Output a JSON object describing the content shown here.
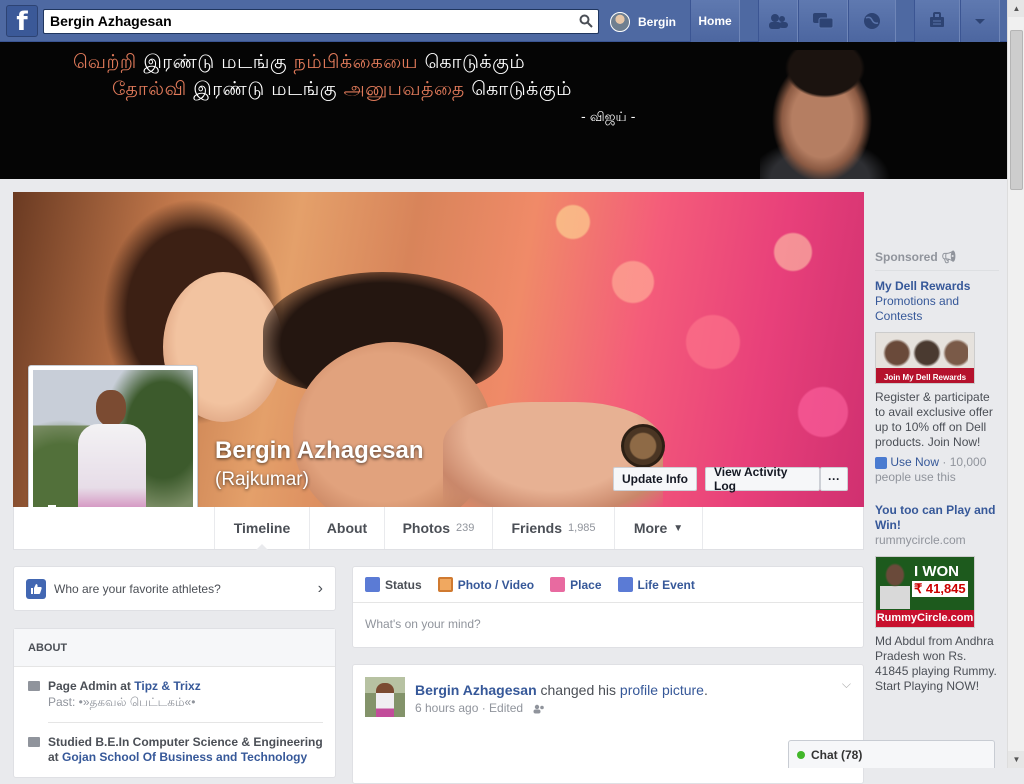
{
  "topbar": {
    "logo": "f",
    "search_value": "Bergin Azhagesan",
    "profile_name": "Bergin",
    "home_label": "Home",
    "icons": [
      "friends-icon",
      "messages-icon",
      "globe-icon",
      "privacy-icon",
      "account-menu-icon"
    ]
  },
  "banner": {
    "line1_hl1": "வெற்றி",
    "line1_mid": "இரண்டு மடங்கு",
    "line1_hl2": "நம்பிக்கையை",
    "line1_end": "கொடுக்கும்",
    "line2_hl1": "தோல்வி",
    "line2_mid": "இரண்டு மடங்கு",
    "line2_hl2": "அனுபவத்தை",
    "line2_end": "கொடுக்கும்",
    "signature": "- விஜய் -"
  },
  "cover": {
    "name": "Bergin Azhagesan",
    "alt_name": "(Rajkumar)",
    "update_info": "Update Info",
    "activity_log": "View Activity Log",
    "more_dots": "···"
  },
  "tabs": [
    {
      "label": "Timeline",
      "count": ""
    },
    {
      "label": "About",
      "count": ""
    },
    {
      "label": "Photos",
      "count": "239"
    },
    {
      "label": "Friends",
      "count": "1,985"
    },
    {
      "label": "More",
      "count": ""
    }
  ],
  "athletes_prompt": "Who are your favorite athletes?",
  "about": {
    "header": "ABOUT",
    "work_prefix": "Page Admin at ",
    "work_place": "Tipz & Trixz",
    "work_past": "Past: •»தகவல் பெட்டகம்«•",
    "edu_prefix": "Studied B.E.In Computer Science & Engineering",
    "edu_at": "at ",
    "edu_school": "Gojan School Of Business and Technology"
  },
  "composer": {
    "status": "Status",
    "photo_video": "Photo / Video",
    "place": "Place",
    "life_event": "Life Event",
    "placeholder": "What's on your mind?"
  },
  "post": {
    "author": "Bergin Azhagesan",
    "action": " changed his ",
    "object": "profile picture",
    "end": ".",
    "time": "6 hours ago · Edited"
  },
  "sponsored": {
    "label": "Sponsored",
    "ad1_title": "My Dell Rewards",
    "ad1_sub": "Promotions and Contests",
    "ad1_img_text": "Join My Dell Rewards",
    "ad1_body": "Register & participate to avail exclusive offer up to 10% off on Dell products. Join Now!",
    "ad1_use": "Use Now",
    "ad1_users": " · 10,000 people use this",
    "ad2_title": "You too can Play and Win!",
    "ad2_domain": "rummycircle.com",
    "ad2_img_won": "I WON",
    "ad2_img_amount": "₹ 41,845",
    "ad2_img_brand": "RummyCircle.com",
    "ad2_body": "Md Abdul from Andhra Pradesh won Rs. 41845 playing Rummy. Start Playing NOW!"
  },
  "chat": {
    "label": "Chat (78)"
  }
}
